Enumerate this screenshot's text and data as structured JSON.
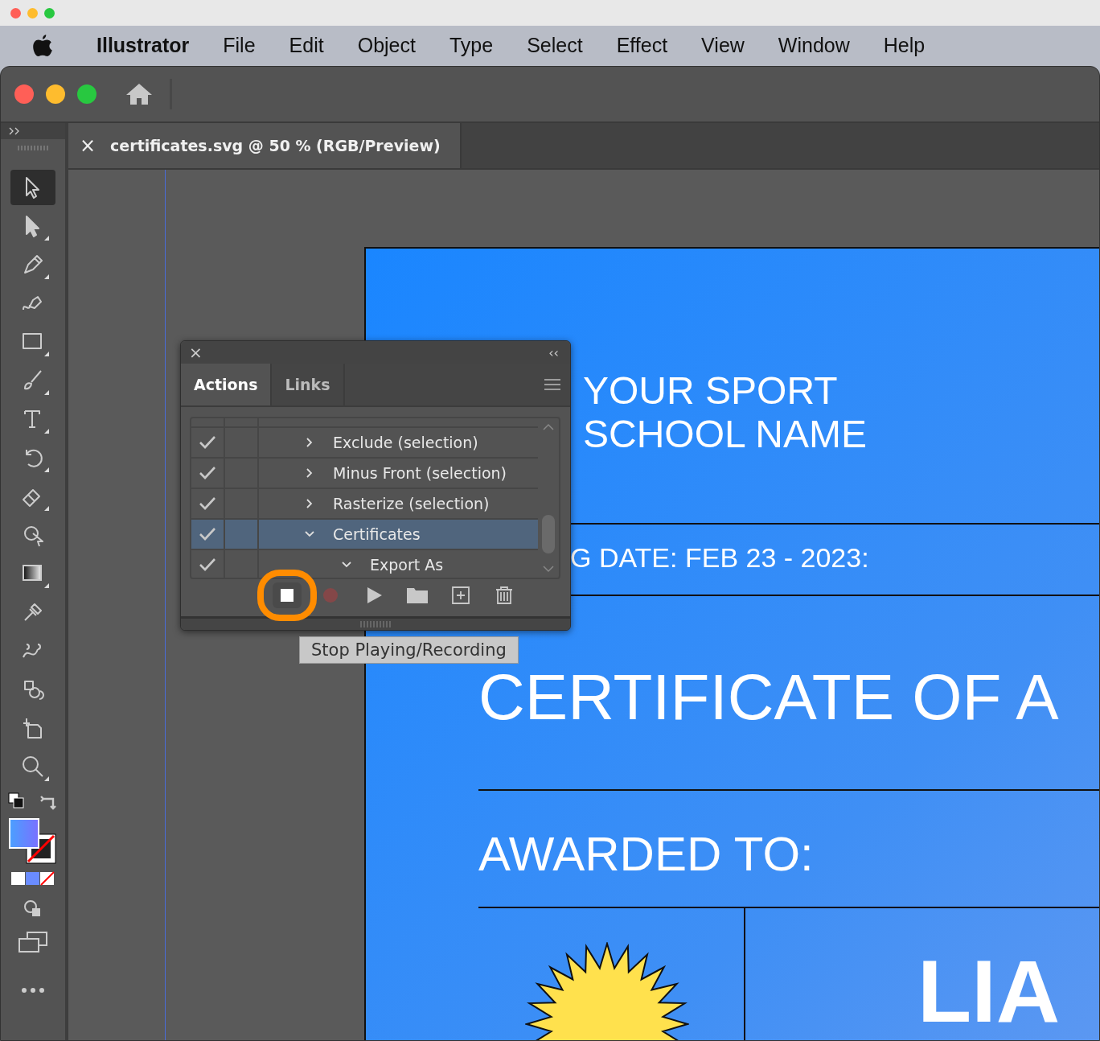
{
  "menu_bar": {
    "app_name": "Illustrator",
    "items": [
      "File",
      "Edit",
      "Object",
      "Type",
      "Select",
      "Effect",
      "View",
      "Window",
      "Help"
    ]
  },
  "document_tab": {
    "close": "×",
    "title": "certificates.svg @ 50 % (RGB/Preview)"
  },
  "tools": [
    {
      "kind": "selection",
      "selected": true,
      "flyout": false
    },
    {
      "kind": "direct",
      "selected": false,
      "flyout": true
    },
    {
      "kind": "pen",
      "selected": false,
      "flyout": true
    },
    {
      "kind": "curvature",
      "selected": false,
      "flyout": false
    },
    {
      "kind": "rectangle",
      "selected": false,
      "flyout": true
    },
    {
      "kind": "brush",
      "selected": false,
      "flyout": true
    },
    {
      "kind": "type",
      "selected": false,
      "flyout": true
    },
    {
      "kind": "rotate",
      "selected": false,
      "flyout": true
    },
    {
      "kind": "eraser",
      "selected": false,
      "flyout": true
    },
    {
      "kind": "shapebuilder",
      "selected": false,
      "flyout": false
    },
    {
      "kind": "gradient",
      "selected": false,
      "flyout": true
    },
    {
      "kind": "eyedropper",
      "selected": false,
      "flyout": false
    },
    {
      "kind": "puppet",
      "selected": false,
      "flyout": false
    },
    {
      "kind": "blend",
      "selected": false,
      "flyout": false
    },
    {
      "kind": "artboard",
      "selected": false,
      "flyout": false
    },
    {
      "kind": "zoom",
      "selected": false,
      "flyout": true
    }
  ],
  "artboard": {
    "heading": [
      "YOUR SPORT",
      "SCHOOL NAME"
    ],
    "date_parts": [
      "G DATE: FEB",
      "23",
      "-",
      "2023:"
    ],
    "title": "CERTIFICATE OF A",
    "awarded": "AWARDED TO:",
    "name": "LIA"
  },
  "actions_panel": {
    "close": "×",
    "collapse": "‹‹",
    "tabs": [
      {
        "label": "Actions",
        "selected": true
      },
      {
        "label": "Links",
        "selected": false
      }
    ],
    "rows": [
      {
        "name": "Exclude (selection)",
        "checked": true,
        "expanded": false,
        "selected": false
      },
      {
        "name": "Minus Front (selection)",
        "checked": true,
        "expanded": false,
        "selected": false
      },
      {
        "name": "Rasterize (selection)",
        "checked": true,
        "expanded": false,
        "selected": false
      },
      {
        "name": "Certificates",
        "checked": true,
        "expanded": true,
        "selected": true,
        "children": [
          {
            "name": "Export As",
            "checked": true,
            "expanded": true,
            "selected": false
          }
        ]
      }
    ],
    "buttons": [
      {
        "kind": "stop",
        "disabled": false,
        "highlighted": true
      },
      {
        "kind": "record",
        "disabled": true,
        "highlighted": false
      },
      {
        "kind": "play",
        "disabled": false,
        "highlighted": false
      },
      {
        "kind": "folder",
        "disabled": false,
        "highlighted": false
      },
      {
        "kind": "new",
        "disabled": false,
        "highlighted": false
      },
      {
        "kind": "trash",
        "disabled": false,
        "highlighted": false
      }
    ]
  },
  "tooltip": "Stop Playing/Recording"
}
